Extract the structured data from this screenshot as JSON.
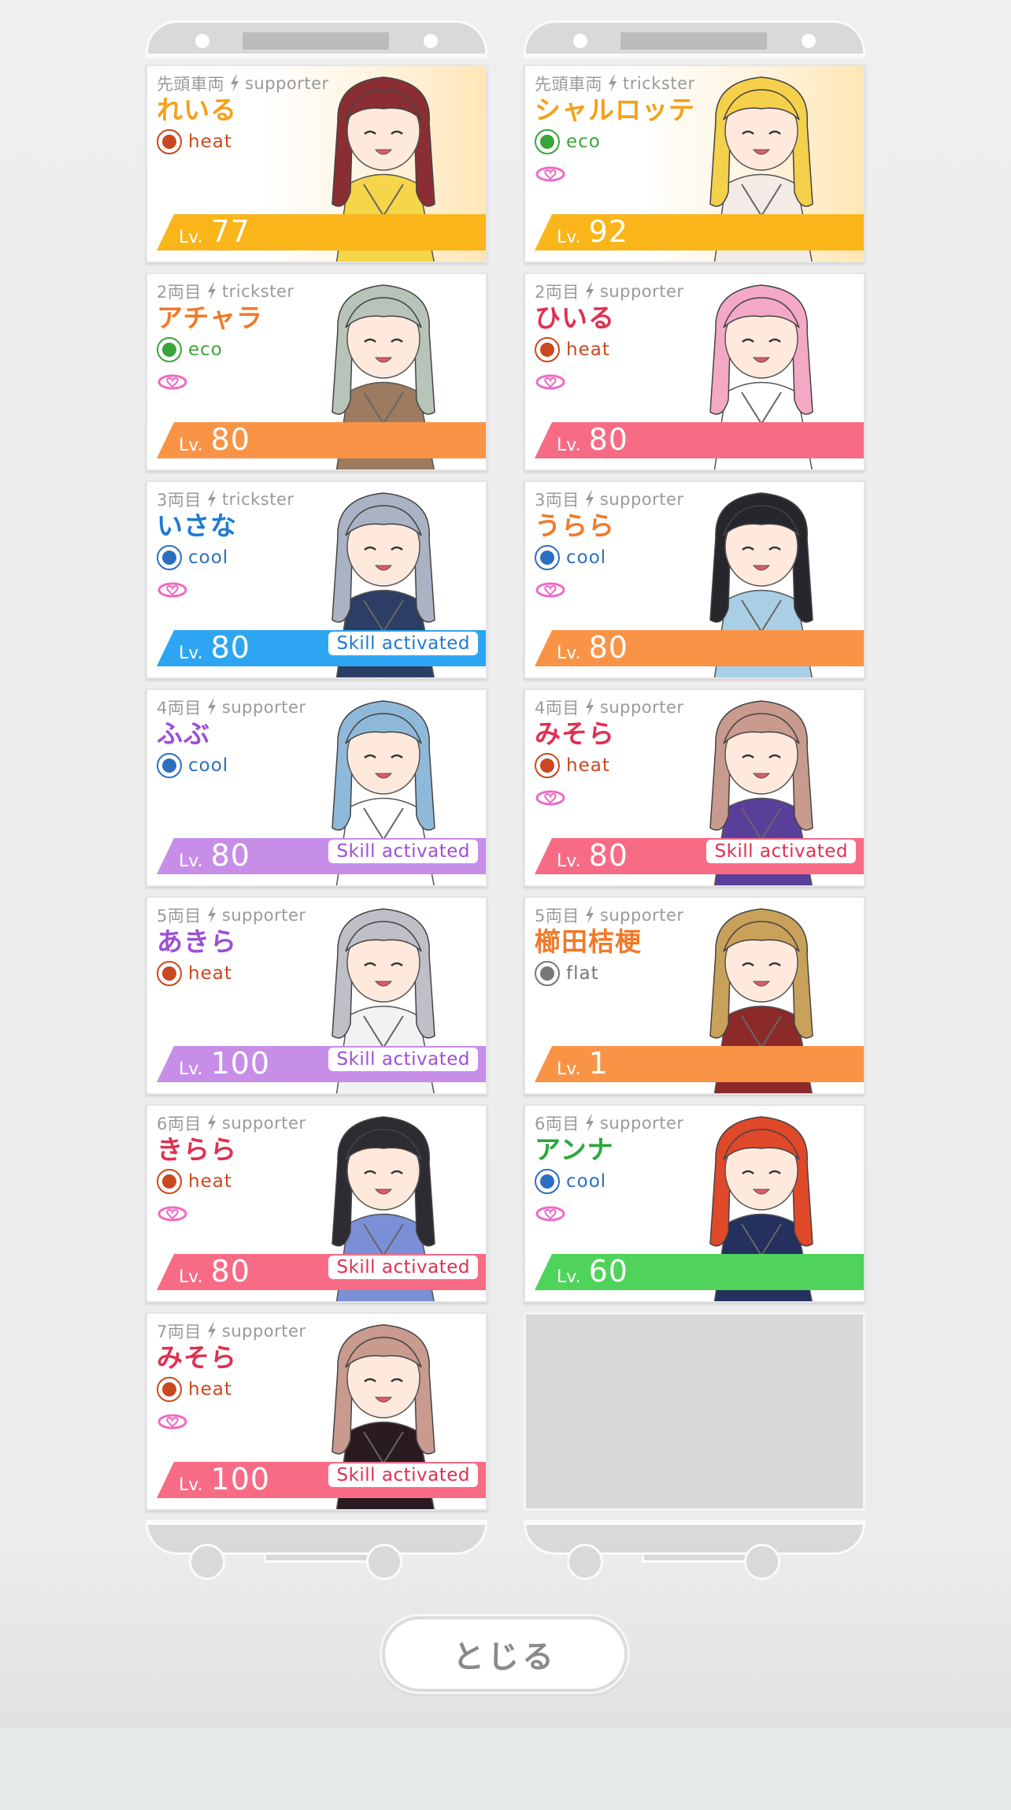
{
  "trains": [
    {
      "cars": [
        {
          "position": "先頭車両",
          "role": "supporter",
          "name": "れいる",
          "name_color": "#f4a019",
          "attribute": "heat",
          "attr_color": "#c9481f",
          "link": false,
          "level_prefix": "Lv.",
          "level": "77",
          "bar_color": "#f9b51a",
          "skill": "",
          "skill_color": "",
          "lead": true,
          "art": {
            "hair": "#8b2e34",
            "outfit": "#f5d64a"
          }
        },
        {
          "position": "2両目",
          "role": "trickster",
          "name": "アチャラ",
          "name_color": "#f07a2a",
          "attribute": "eco",
          "attr_color": "#3aa43a",
          "link": true,
          "level_prefix": "Lv.",
          "level": "80",
          "bar_color": "#f99447",
          "skill": "",
          "skill_color": "",
          "lead": false,
          "art": {
            "hair": "#b8c4b8",
            "outfit": "#9c7b61"
          }
        },
        {
          "position": "3両目",
          "role": "trickster",
          "name": "いさな",
          "name_color": "#1f7ad1",
          "attribute": "cool",
          "attr_color": "#2d6fbf",
          "link": true,
          "level_prefix": "Lv.",
          "level": "80",
          "bar_color": "#2ea5f2",
          "skill": "Skill activated",
          "skill_color": "#1f7ad1",
          "lead": false,
          "art": {
            "hair": "#a9b3c4",
            "outfit": "#2c3e63"
          }
        },
        {
          "position": "4両目",
          "role": "supporter",
          "name": "ふぶ",
          "name_color": "#9d4fd6",
          "attribute": "cool",
          "attr_color": "#2d6fbf",
          "link": false,
          "level_prefix": "Lv.",
          "level": "80",
          "bar_color": "#c78ee8",
          "skill": "Skill activated",
          "skill_color": "#9d4fd6",
          "lead": false,
          "art": {
            "hair": "#8fb9d9",
            "outfit": "#ffffff"
          }
        },
        {
          "position": "5両目",
          "role": "supporter",
          "name": "あきら",
          "name_color": "#9d4fd6",
          "attribute": "heat",
          "attr_color": "#c9481f",
          "link": false,
          "level_prefix": "Lv.",
          "level": "100",
          "bar_color": "#c78ee8",
          "skill": "Skill activated",
          "skill_color": "#9d4fd6",
          "lead": false,
          "art": {
            "hair": "#bfbfc8",
            "outfit": "#f2f2f2"
          }
        },
        {
          "position": "6両目",
          "role": "supporter",
          "name": "きらら",
          "name_color": "#e03050",
          "attribute": "heat",
          "attr_color": "#c9481f",
          "link": true,
          "level_prefix": "Lv.",
          "level": "80",
          "bar_color": "#f86b85",
          "skill": "Skill activated",
          "skill_color": "#e03050",
          "lead": false,
          "art": {
            "hair": "#2c2c32",
            "outfit": "#7a8fd6"
          }
        },
        {
          "position": "7両目",
          "role": "supporter",
          "name": "みそら",
          "name_color": "#e03050",
          "attribute": "heat",
          "attr_color": "#c9481f",
          "link": true,
          "level_prefix": "Lv.",
          "level": "100",
          "bar_color": "#f86b85",
          "skill": "Skill activated",
          "skill_color": "#e03050",
          "lead": false,
          "art": {
            "hair": "#c99a8e",
            "outfit": "#2a1a22"
          }
        }
      ]
    },
    {
      "cars": [
        {
          "position": "先頭車両",
          "role": "trickster",
          "name": "シャルロッテ",
          "name_color": "#f4a019",
          "attribute": "eco",
          "attr_color": "#3aa43a",
          "link": true,
          "level_prefix": "Lv.",
          "level": "92",
          "bar_color": "#f9b51a",
          "skill": "",
          "skill_color": "",
          "lead": true,
          "art": {
            "hair": "#f5d04a",
            "outfit": "#f3ece6"
          }
        },
        {
          "position": "2両目",
          "role": "supporter",
          "name": "ひいる",
          "name_color": "#e03050",
          "attribute": "heat",
          "attr_color": "#c9481f",
          "link": true,
          "level_prefix": "Lv.",
          "level": "80",
          "bar_color": "#f86b85",
          "skill": "",
          "skill_color": "",
          "lead": false,
          "art": {
            "hair": "#f3a9c5",
            "outfit": "#ffffff"
          }
        },
        {
          "position": "3両目",
          "role": "supporter",
          "name": "うらら",
          "name_color": "#f07a2a",
          "attribute": "cool",
          "attr_color": "#2d6fbf",
          "link": true,
          "level_prefix": "Lv.",
          "level": "80",
          "bar_color": "#f99447",
          "skill": "",
          "skill_color": "",
          "lead": false,
          "art": {
            "hair": "#26262c",
            "outfit": "#a9cfe6"
          }
        },
        {
          "position": "4両目",
          "role": "supporter",
          "name": "みそら",
          "name_color": "#e03050",
          "attribute": "heat",
          "attr_color": "#c9481f",
          "link": true,
          "level_prefix": "Lv.",
          "level": "80",
          "bar_color": "#f86b85",
          "skill": "Skill activated",
          "skill_color": "#e03050",
          "lead": false,
          "art": {
            "hair": "#c99a8e",
            "outfit": "#5a3f9a"
          }
        },
        {
          "position": "5両目",
          "role": "supporter",
          "name": "櫛田桔梗",
          "name_color": "#f07a2a",
          "attribute": "flat",
          "attr_color": "#777777",
          "link": false,
          "level_prefix": "Lv.",
          "level": "1",
          "bar_color": "#f99447",
          "skill": "",
          "skill_color": "",
          "lead": false,
          "art": {
            "hair": "#c9a15a",
            "outfit": "#8c2a2a"
          }
        },
        {
          "position": "6両目",
          "role": "supporter",
          "name": "アンナ",
          "name_color": "#2aa83a",
          "attribute": "cool",
          "attr_color": "#2d6fbf",
          "link": true,
          "level_prefix": "Lv.",
          "level": "60",
          "bar_color": "#4fd35a",
          "skill": "",
          "skill_color": "",
          "lead": false,
          "art": {
            "hair": "#e0482a",
            "outfit": "#24305e"
          }
        },
        {
          "empty": true
        }
      ]
    }
  ],
  "close_button": {
    "label": "とじる"
  }
}
